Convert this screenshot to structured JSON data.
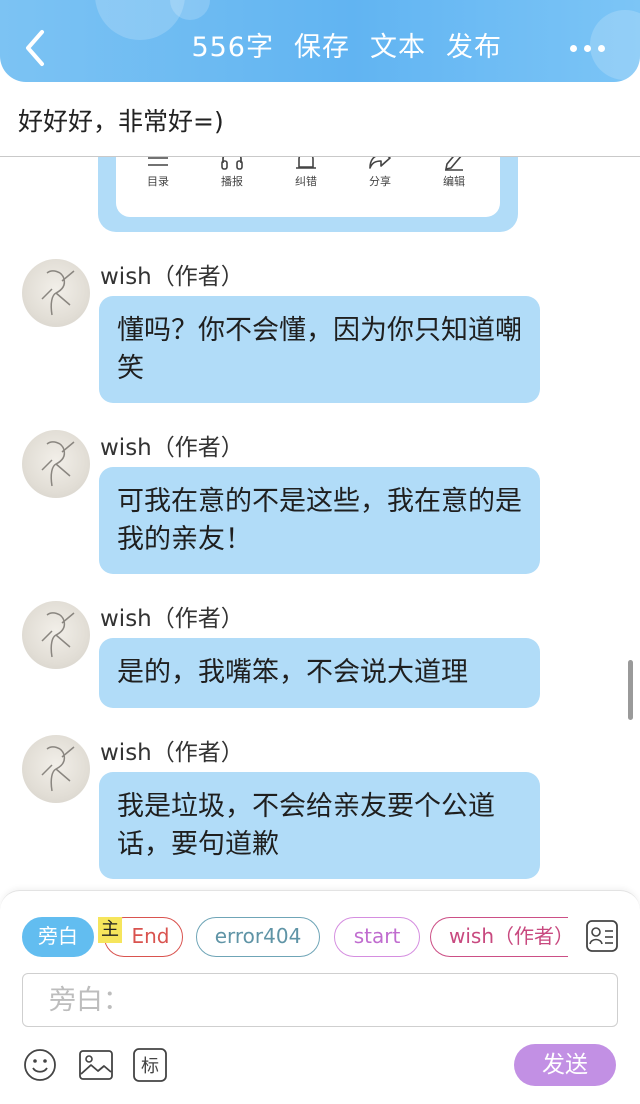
{
  "header": {
    "word_count": "556字",
    "save_label": "保存",
    "text_label": "文本",
    "publish_label": "发布"
  },
  "title": "好好好，非常好=)",
  "card_toolbar": {
    "items": [
      "目录",
      "播报",
      "纠错",
      "分享",
      "编辑"
    ]
  },
  "messages": [
    {
      "author": "wish（作者）",
      "text": "懂吗？你不会懂，因为你只知道嘲笑"
    },
    {
      "author": "wish（作者）",
      "text": "可我在意的不是这些，我在意的是我的亲友！"
    },
    {
      "author": "wish（作者）",
      "text": "是的，我嘴笨，不会说大道理"
    },
    {
      "author": "wish（作者）",
      "text": "我是垃圾，不会给亲友要个公道话，要句道歉"
    }
  ],
  "roles": {
    "aside": "旁白",
    "main_tag": "主",
    "end": "End",
    "error404": "error404",
    "start": "start",
    "wish": "wish（作者）"
  },
  "composer": {
    "placeholder": "旁白：",
    "mark_label": "标",
    "send_label": "发送"
  },
  "colors": {
    "header": "#61b4f2",
    "bubble": "#b1dcf8",
    "send": "#c290e4",
    "aside_chip": "#62bdf0"
  },
  "icons": [
    "back-icon",
    "more-icon",
    "toc-icon",
    "headphones-icon",
    "alarm-icon",
    "share-icon",
    "edit-icon",
    "contact-card-icon",
    "emoji-icon",
    "image-icon"
  ]
}
